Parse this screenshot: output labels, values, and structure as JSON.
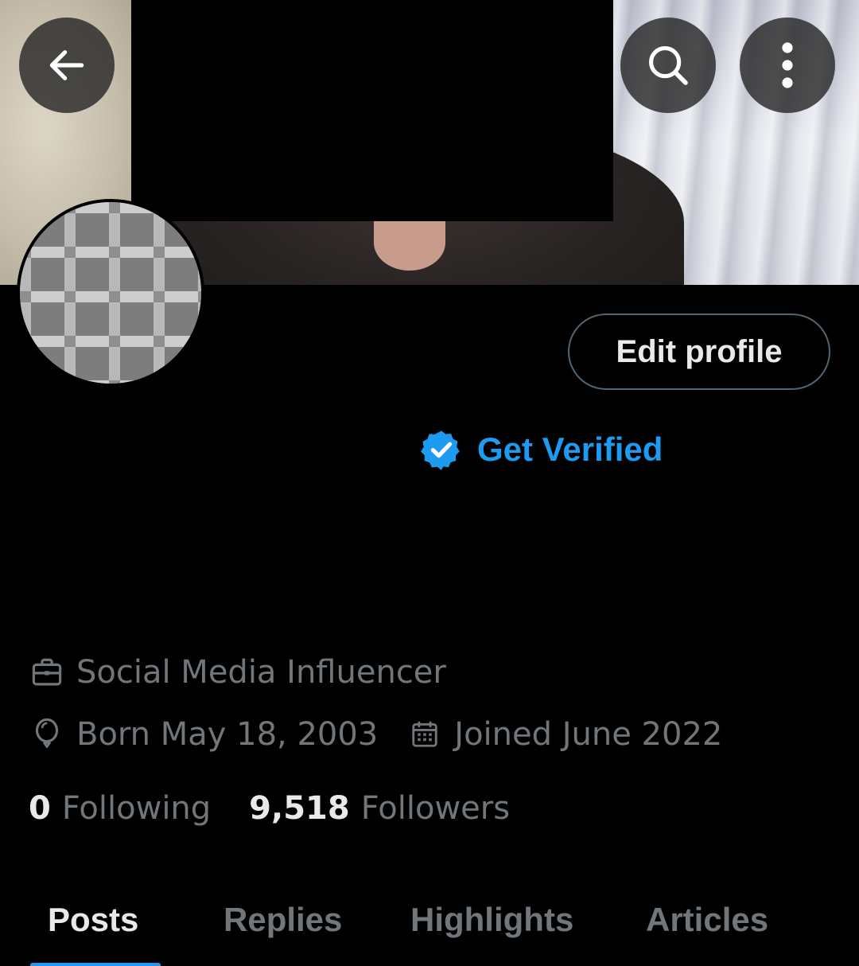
{
  "header": {
    "back_icon": "arrow-left-icon",
    "search_icon": "search-icon",
    "more_icon": "more-vertical-icon"
  },
  "profile": {
    "edit_button_label": "Edit profile",
    "get_verified_label": "Get Verified",
    "verified_icon": "verified-badge-icon",
    "profession": "Social Media Influencer",
    "birthday": "Born May 18, 2003",
    "joined": "Joined June 2022"
  },
  "stats": {
    "following_count": "0",
    "following_label": "Following",
    "followers_count": "9,518",
    "followers_label": "Followers"
  },
  "tabs": [
    {
      "label": "Posts",
      "active": true
    },
    {
      "label": "Replies",
      "active": false
    },
    {
      "label": "Highlights",
      "active": false
    },
    {
      "label": "Articles",
      "active": false
    }
  ],
  "colors": {
    "accent": "#1d9bf0",
    "background": "#000000",
    "primary_text": "#e7e9ea",
    "secondary_text": "#71767b",
    "border": "#536471"
  }
}
